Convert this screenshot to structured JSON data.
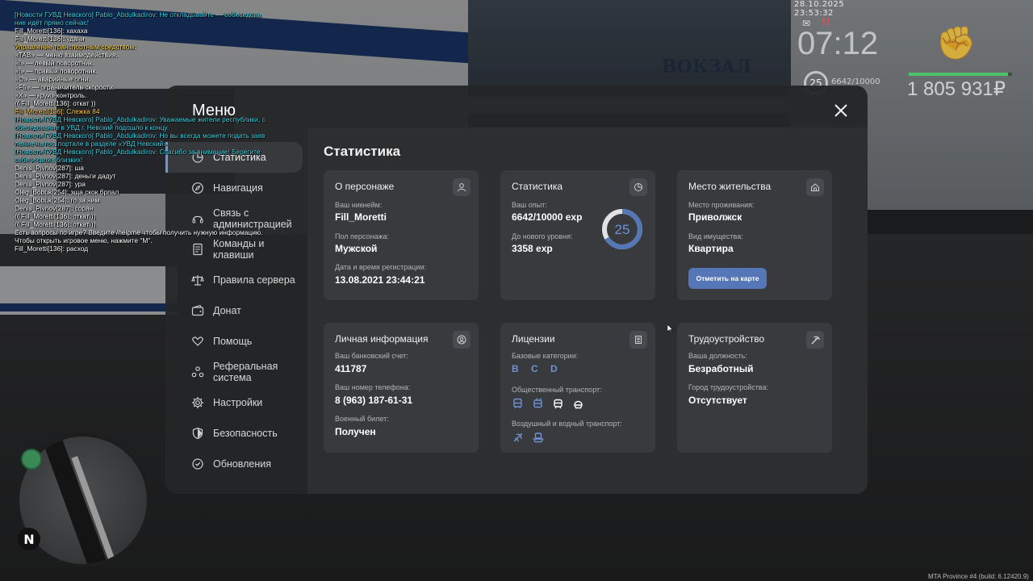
{
  "hud": {
    "datetime": "28.10.2025 23:53:32",
    "time": "07:12",
    "level": "25",
    "exp": "6642/10000",
    "money": "1 805 931₽",
    "health": 0.96
  },
  "chat": [
    {
      "color": "c-news",
      "text": "[Новости ГУВД Невского] Pablo_Abdulkadirov: Не откладывайте — собеседова"
    },
    {
      "color": "c-news",
      "text": "ние идёт прямо сейчас!"
    },
    {
      "color": "c-white",
      "text": "Fill_Moretti[136]: хахаха"
    },
    {
      "color": "c-white",
      "text": "Fill_Moretti[136]: удачи"
    },
    {
      "color": "c-yellow",
      "text": "Управление транспортным средством:"
    },
    {
      "color": "c-white",
      "text": "«TAB» — меню взаимодействия."
    },
    {
      "color": "c-white",
      "text": "«[» — левый поворотник."
    },
    {
      "color": "c-white",
      "text": "«]» — правый поворотник."
    },
    {
      "color": "c-white",
      "text": "«O» — аварийные огни."
    },
    {
      "color": "c-white",
      "text": "«F5» — ограничитель скорости."
    },
    {
      "color": "c-white",
      "text": "«X» — круиз-контроль."
    },
    {
      "color": "c-white",
      "text": "(( Fill_Moretti[136]: откат ))"
    },
    {
      "color": "c-orange",
      "text": "Fill_Moretti[136]: Слежка 84"
    },
    {
      "color": "c-news",
      "text": "[Новости ГУВД Невского] Pablo_Abdulkadirov: Уважаемые жители республики, с"
    },
    {
      "color": "c-news",
      "text": "обеседование в УВД г. Невский подошло к концу."
    },
    {
      "color": "c-news",
      "text": "[Новости ГУВД Невского] Pablo_Abdulkadirov: Но вы всегда можете подать заяв"
    },
    {
      "color": "c-news",
      "text": "ление на гос. портале в разделе «УВД Невский»."
    },
    {
      "color": "c-news",
      "text": "[Новости ГУВД Невского] Pablo_Abdulkadirov: Спасибо за внимание! Берегите"
    },
    {
      "color": "c-news",
      "text": " себя и своих близких!"
    },
    {
      "color": "c-white",
      "text": "Denis_Pivnov[287]: ша"
    },
    {
      "color": "c-white",
      "text": "Denis_Pivnov[287]: деньги дадут"
    },
    {
      "color": "c-white",
      "text": "Denis_Pivnov[287]: ура"
    },
    {
      "color": "c-white",
      "text": "Oleg_Bobuk[254]: зща скок брпал"
    },
    {
      "color": "c-white",
      "text": "Oleg_Bobuk[254]: го за ним"
    },
    {
      "color": "c-white",
      "text": "Denis_Pivnov[287]: сорян"
    },
    {
      "color": "c-white",
      "text": "(( Fill_Moretti[136]: откат ))"
    },
    {
      "color": "c-white",
      "text": "(( Fill_Moretti[136]: откат ))"
    },
    {
      "color": "c-white",
      "text": "Есть вопросы по игре? Введите /helpme чтобы получить нужную информацию."
    },
    {
      "color": "c-white",
      "text": "Чтобы открыть игровое меню, нажмите \"M\"."
    },
    {
      "color": "c-white",
      "text": "Fill_Moretti[136]: расход"
    }
  ],
  "world": {
    "station_sign": "ВОКЗАЛ",
    "build": "MTA Province #4 (build: 6.12420.9)",
    "north": "N"
  },
  "menu": {
    "title": "Меню",
    "nav": [
      {
        "label": "Статистика",
        "icon": "pie-chart-icon",
        "active": true
      },
      {
        "label": "Навигация",
        "icon": "compass-icon"
      },
      {
        "label": "Связь с администрацией",
        "icon": "headset-icon"
      },
      {
        "label": "Команды и клавиши",
        "icon": "document-icon"
      },
      {
        "label": "Правила сервера",
        "icon": "scales-icon"
      },
      {
        "label": "Донат",
        "icon": "wallet-icon"
      },
      {
        "label": "Помощь",
        "icon": "heart-hand-icon"
      },
      {
        "label": "Реферальная система",
        "icon": "referral-icon"
      },
      {
        "label": "Настройки",
        "icon": "gear-icon"
      },
      {
        "label": "Безопасность",
        "icon": "shield-icon"
      },
      {
        "label": "Обновления",
        "icon": "update-icon"
      }
    ]
  },
  "stats": {
    "title": "Статистика",
    "character": {
      "title": "О персонаже",
      "nickname_label": "Ваш никнейм:",
      "nickname": "Fill_Moretti",
      "gender_label": "Пол персонажа:",
      "gender": "Мужской",
      "reg_label": "Дата и время регистрации:",
      "reg": "13.08.2021 23:44:21"
    },
    "statistics": {
      "title": "Статистика",
      "exp_label": "Ваш опыт:",
      "exp": "6642/10000 exp",
      "next_label": "До нового уровня:",
      "next": "3358 exp",
      "level": "25",
      "progress": 0.6642
    },
    "residence": {
      "title": "Место жительства",
      "place_label": "Место проживания:",
      "place": "Приволжск",
      "property_label": "Вид имущества:",
      "property": "Квартира",
      "map_button": "Отметить на карте"
    },
    "personal": {
      "title": "Личная информация",
      "bank_label": "Ваш банковский счет:",
      "bank": "411787",
      "phone_label": "Ваш номер телефона:",
      "phone": "8 (963) 187-61-31",
      "military_label": "Военный билет:",
      "military": "Получен"
    },
    "licenses": {
      "title": "Лицензии",
      "base_label": "Базовые категории:",
      "base": "B C D",
      "public_label": "Общественный транспорт:",
      "air_label": "Воздушный и водный транспорт:"
    },
    "employment": {
      "title": "Трудоустройство",
      "position_label": "Ваша должность:",
      "position": "Безработный",
      "city_label": "Город трудоустройства:",
      "city": "Отсутствует"
    }
  },
  "colors": {
    "accent": "#6f94d8",
    "button": "#5577b8",
    "card": "#383a3d",
    "panel": "#2d2e30"
  }
}
